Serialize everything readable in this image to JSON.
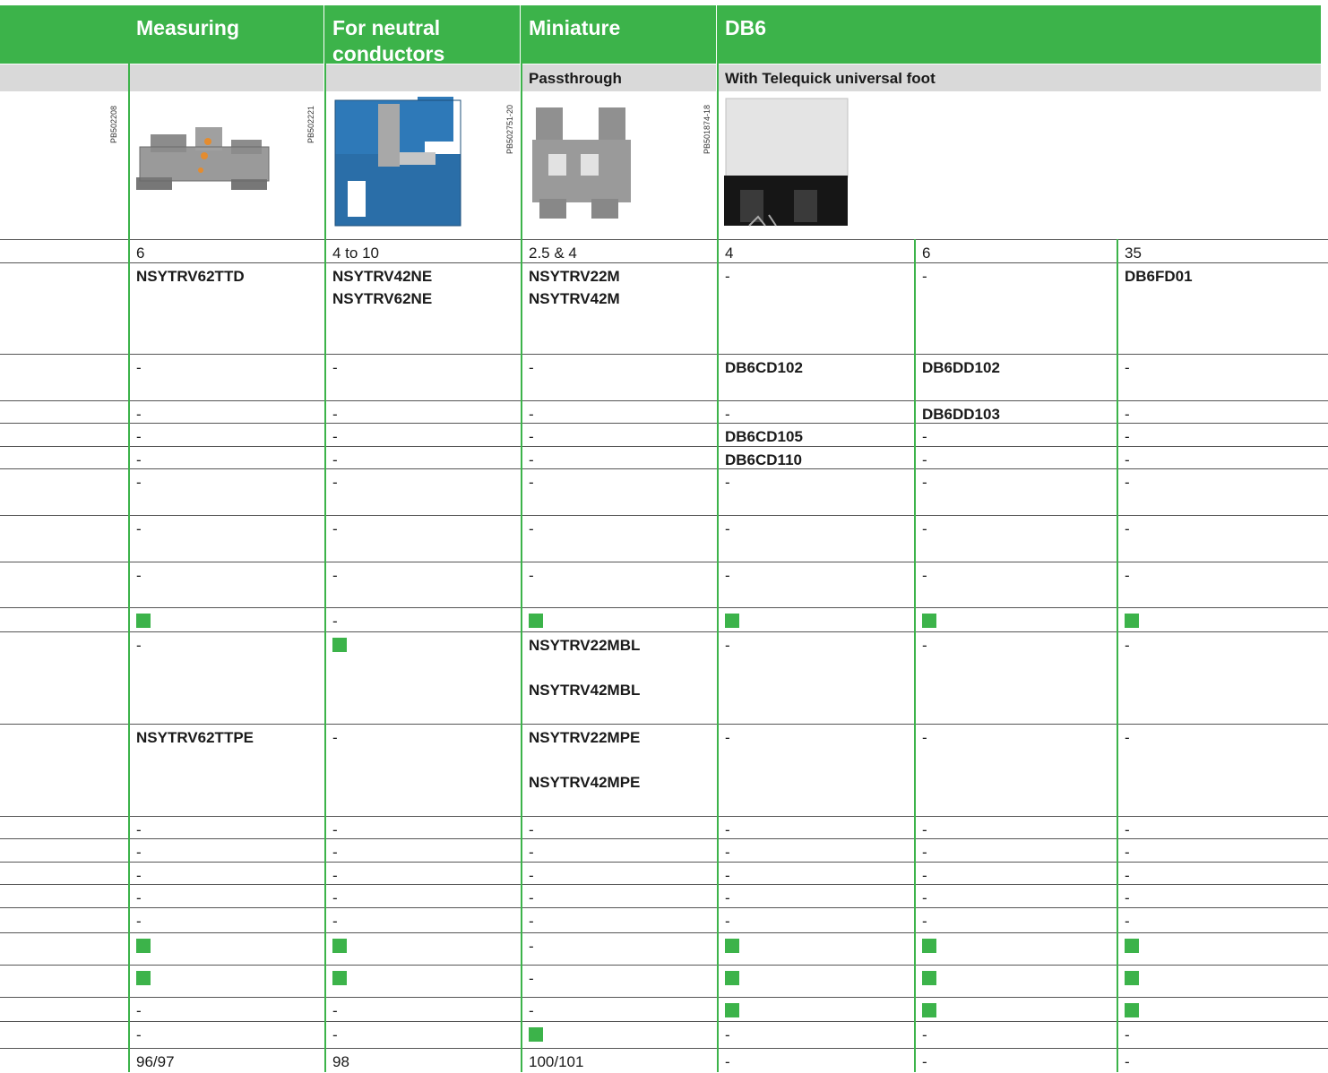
{
  "colors": {
    "accent": "#3cb34a",
    "subheader": "#d9d9d9"
  },
  "header": {
    "measuring": "Measuring",
    "neutral": "For neutral\nconductors",
    "miniature": "Miniature",
    "db6": "DB6"
  },
  "subheader": {
    "miniature": "Passthrough",
    "db6": "With Telequick universal foot"
  },
  "image_codes": [
    "PB502208",
    "PB502221",
    "PB502751-20",
    "PB501874-18"
  ],
  "images": [
    "grey-measuring-terminal-block",
    "blue-neutral-terminal-block",
    "grey-miniature-terminal-block",
    "db6-terminal-block"
  ],
  "rows": [
    [
      "6",
      "4 to 10",
      "2.5 & 4",
      "4",
      "6",
      "35"
    ],
    [
      "NSYTRV62TTD",
      "NSYTRV42NE\nNSYTRV62NE",
      "NSYTRV22M\nNSYTRV42M",
      "-",
      "-",
      "DB6FD01"
    ],
    [
      "-",
      "-",
      "-",
      "DB6CD102",
      "DB6DD102",
      "-"
    ],
    [
      "-",
      "-",
      "-",
      "-",
      "DB6DD103",
      "-"
    ],
    [
      "-",
      "-",
      "-",
      "DB6CD105",
      "-",
      "-"
    ],
    [
      "-",
      "-",
      "-",
      "DB6CD110",
      "-",
      "-"
    ],
    [
      "-",
      "-",
      "-",
      "-",
      "-",
      "-"
    ],
    [
      "-",
      "-",
      "-",
      "-",
      "-",
      "-"
    ],
    [
      "-",
      "-",
      "-",
      "-",
      "-",
      "-"
    ],
    [
      "■",
      "-",
      "■",
      "■",
      "■",
      "■"
    ],
    [
      "-",
      "■",
      "NSYTRV22MBL\n\nNSYTRV42MBL",
      "-",
      "-",
      "-"
    ],
    [
      "NSYTRV62TTPE",
      "-",
      "NSYTRV22MPE\n\nNSYTRV42MPE",
      "-",
      "-",
      "-"
    ],
    [
      "-",
      "-",
      "-",
      "-",
      "-",
      "-"
    ],
    [
      "-",
      "-",
      "-",
      "-",
      "-",
      "-"
    ],
    [
      "-",
      "-",
      "-",
      "-",
      "-",
      "-"
    ],
    [
      "-",
      "-",
      "-",
      "-",
      "-",
      "-"
    ],
    [
      "-",
      "-",
      "-",
      "-",
      "-",
      "-"
    ],
    [
      "■",
      "■",
      "-",
      "■",
      "■",
      "■"
    ],
    [
      "■",
      "■",
      "-",
      "■",
      "■",
      "■"
    ],
    [
      "-",
      "-",
      "-",
      "■",
      "■",
      "■"
    ],
    [
      "-",
      "-",
      "■",
      "-",
      "-",
      "-"
    ],
    [
      "96/97",
      "98",
      "100/101",
      "-",
      "-",
      "-"
    ]
  ]
}
